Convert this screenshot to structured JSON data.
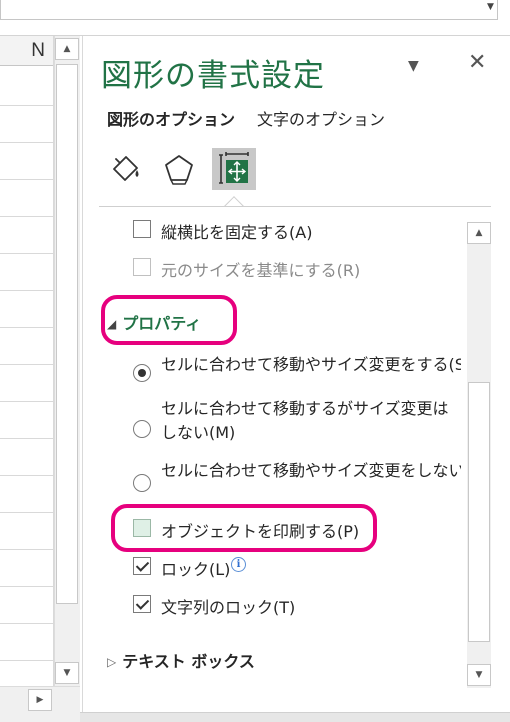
{
  "sheet": {
    "column_header": "N"
  },
  "scrollbar": {
    "up_arrow": "▲",
    "down_arrow": "▼",
    "right_arrow": "▶",
    "dropdown_arrow": "▼"
  },
  "pane": {
    "title": "図形の書式設定",
    "menu_icon": "chevron-down-icon",
    "menu_glyph": "▼",
    "close_glyph": "✕",
    "tabs": [
      {
        "label": "図形のオプション",
        "active": true
      },
      {
        "label": "文字のオプション",
        "active": false
      }
    ],
    "icon_buttons": [
      {
        "name": "fill-line-icon",
        "selected": false
      },
      {
        "name": "effects-pentagon-icon",
        "selected": false
      },
      {
        "name": "size-properties-icon",
        "selected": true
      }
    ]
  },
  "options": {
    "lock_aspect": {
      "label": "縦横比を固定する(A)",
      "checked": false
    },
    "relative_original": {
      "label": "元のサイズを基準にする(R)",
      "checked": false,
      "disabled": true
    },
    "properties_section": {
      "label": "プロパティ",
      "expanded": true,
      "highlighted": true
    },
    "move_and_size": {
      "label": "セルに合わせて移動やサイズ変更をする(S)",
      "checked": true
    },
    "move_not_size": {
      "label": "セルに合わせて移動するがサイズ変更はしない(M)",
      "checked": false
    },
    "dont_move": {
      "label": "セルに合わせて移動やサイズ変更をしない(D)",
      "checked": false
    },
    "print_object": {
      "label": "オブジェクトを印刷する(P)",
      "checked": false,
      "highlighted": true
    },
    "locked": {
      "label": "ロック(L)",
      "checked": true
    },
    "lock_text": {
      "label": "文字列のロック(T)",
      "checked": true
    },
    "textbox_section": {
      "label": "テキスト ボックス",
      "expanded": false
    }
  },
  "colors": {
    "accent_green": "#217346",
    "highlight_magenta": "#e6007e",
    "selected_icon_bg": "#c8c8c8"
  }
}
